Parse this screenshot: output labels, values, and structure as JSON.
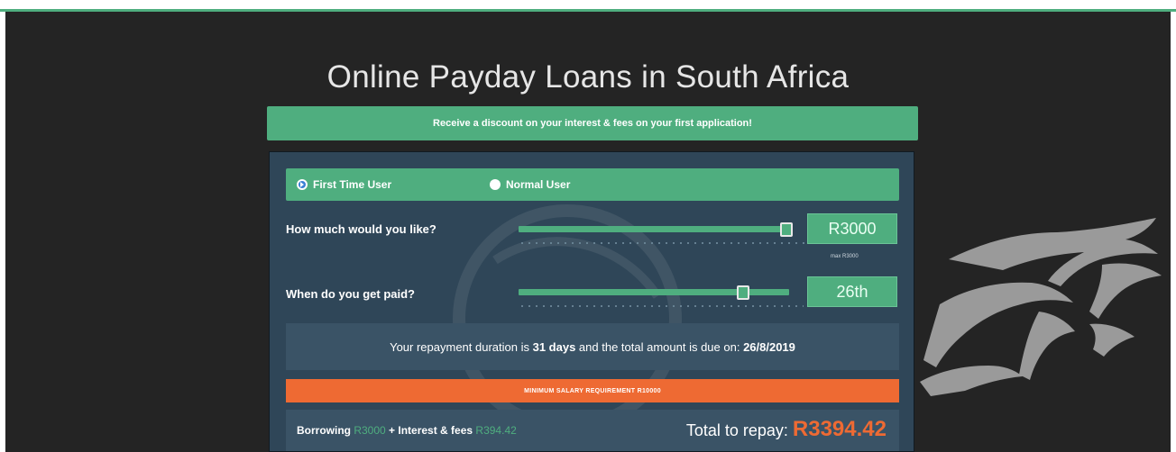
{
  "page": {
    "title": "Online Payday Loans in South Africa",
    "promo_banner": "Receive a discount on your interest & fees on your first application!"
  },
  "user_type": {
    "options": [
      {
        "label": "First Time User",
        "selected": true
      },
      {
        "label": "Normal User",
        "selected": false
      }
    ]
  },
  "amount": {
    "label": "How much would you like?",
    "value": "R3000",
    "max_note": "max R3000",
    "slider_fraction": 1.0
  },
  "payday": {
    "label": "When do you get paid?",
    "value": "26th",
    "slider_fraction": 0.83
  },
  "duration": {
    "prefix": "Your repayment duration is ",
    "days": "31 days",
    "middle": " and the total amount is due on: ",
    "due_date": "26/8/2019"
  },
  "salary_requirement": "MINIMUM SALARY REQUIREMENT R10000",
  "summary": {
    "borrowing_label": "Borrowing ",
    "borrowing_value": "R3000",
    "interest_label": " + Interest & fees ",
    "interest_value": "R394.42",
    "total_label": "Total to repay: ",
    "total_value": "R3394.42"
  },
  "colors": {
    "accent_green": "#4fae7f",
    "accent_orange": "#ee6a33",
    "card_bg": "#2f4658",
    "page_bg": "#242424"
  },
  "icons": {
    "mascot": "panther-icon",
    "radio_selected": "radio-selected-icon",
    "radio_unselected": "radio-unselected-icon"
  }
}
